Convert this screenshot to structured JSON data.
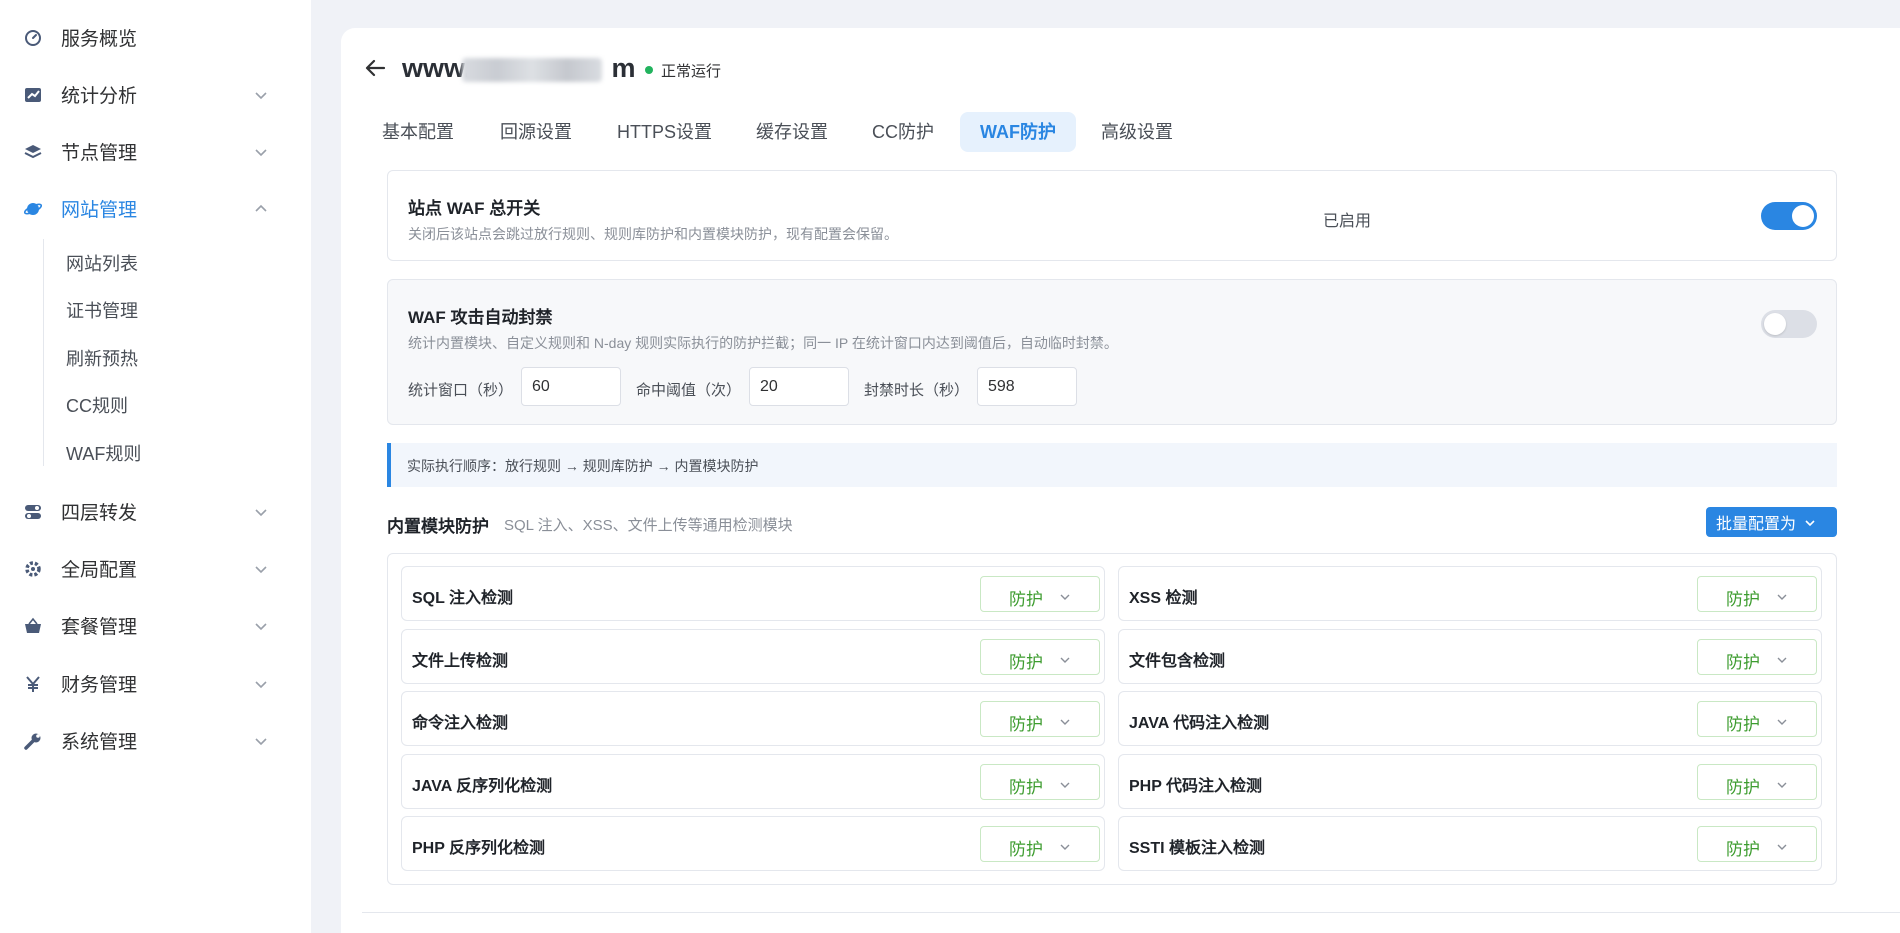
{
  "sidebar": {
    "items": [
      {
        "label": "服务概览",
        "icon": "dashboard-icon"
      },
      {
        "label": "统计分析",
        "icon": "chart-icon"
      },
      {
        "label": "节点管理",
        "icon": "layers-icon"
      },
      {
        "label": "网站管理",
        "icon": "globe-icon",
        "active": true
      },
      {
        "label": "四层转发",
        "icon": "toggle-icon"
      },
      {
        "label": "全局配置",
        "icon": "gear-icon"
      },
      {
        "label": "套餐管理",
        "icon": "basket-icon"
      },
      {
        "label": "财务管理",
        "icon": "yen-icon"
      },
      {
        "label": "系统管理",
        "icon": "wrench-icon"
      }
    ],
    "sub_items": [
      "网站列表",
      "证书管理",
      "刷新预热",
      "CC规则",
      "WAF规则"
    ]
  },
  "header": {
    "site_name": "www.",
    "site_name_suffix": "m",
    "status": "正常运行"
  },
  "tabs": [
    "基本配置",
    "回源设置",
    "HTTPS设置",
    "缓存设置",
    "CC防护",
    "WAF防护",
    "高级设置"
  ],
  "active_tab": "WAF防护",
  "waf_master": {
    "title": "站点 WAF 总开关",
    "desc": "关闭后该站点会跳过放行规则、规则库防护和内置模块防护，现有配置会保留。",
    "state_label": "已启用",
    "enabled": true
  },
  "auto_ban": {
    "title": "WAF 攻击自动封禁",
    "desc": "统计内置模块、自定义规则和 N-day 规则实际执行的防护拦截；同一 IP 在统计窗口内达到阈值后，自动临时封禁。",
    "enabled": false,
    "window_label": "统计窗口（秒）",
    "window_value": "60",
    "threshold_label": "命中阈值（次）",
    "threshold_value": "20",
    "duration_label": "封禁时长（秒）",
    "duration_value": "598"
  },
  "note": "实际执行顺序：放行规则 → 规则库防护 → 内置模块防护",
  "modules_section": {
    "title": "内置模块防护",
    "subtitle": "SQL 注入、XSS、文件上传等通用检测模块",
    "batch_label": "批量配置为",
    "modules": [
      {
        "name": "SQL 注入检测",
        "mode": "防护"
      },
      {
        "name": "XSS 检测",
        "mode": "防护"
      },
      {
        "name": "文件上传检测",
        "mode": "防护"
      },
      {
        "name": "文件包含检测",
        "mode": "防护"
      },
      {
        "name": "命令注入检测",
        "mode": "防护"
      },
      {
        "name": "JAVA 代码注入检测",
        "mode": "防护"
      },
      {
        "name": "JAVA 反序列化检测",
        "mode": "防护"
      },
      {
        "name": "PHP 代码注入检测",
        "mode": "防护"
      },
      {
        "name": "PHP 反序列化检测",
        "mode": "防护"
      },
      {
        "name": "SSTI 模板注入检测",
        "mode": "防护"
      }
    ]
  },
  "colors": {
    "accent": "#2a86e2",
    "status_green": "#22b35e",
    "mode_green": "#3d9c2f"
  }
}
